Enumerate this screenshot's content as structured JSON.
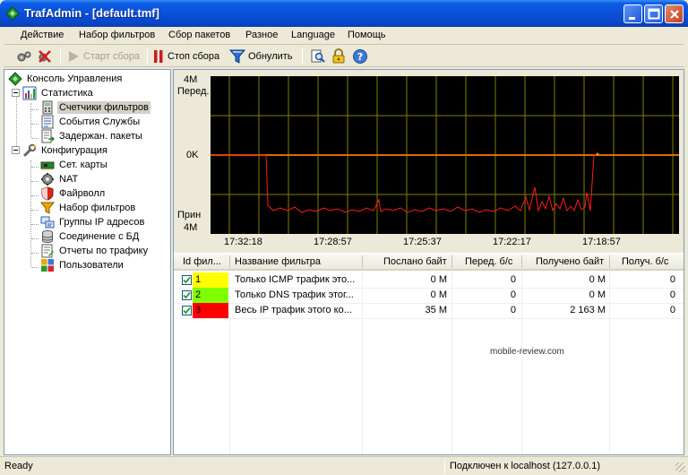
{
  "window": {
    "title": "TrafAdmin - [default.tmf]"
  },
  "menu": [
    "Действие",
    "Набор фильтров",
    "Сбор пакетов",
    "Разное",
    "Language",
    "Помощь"
  ],
  "toolbar": {
    "start_label": "Старт сбора",
    "stop_label": "Стоп сбора",
    "reset_label": "Обнулить"
  },
  "tree": {
    "root": "Консоль Управления",
    "stats": "Статистика",
    "stats_items": [
      "Счетчики фильтров",
      "События Службы",
      "Задержан. пакеты"
    ],
    "config": "Конфигурация",
    "config_items": [
      "Сет. карты",
      "NAT",
      "Файрволл",
      "Набор фильтров",
      "Группы IP адресов",
      "Соединение с БД",
      "Отчеты по трафику",
      "Пользователи"
    ]
  },
  "chart": {
    "top_value": "4M",
    "top_label": "Перед.",
    "mid_value": "0K",
    "bottom_label": "Прин",
    "bottom_value": "4M",
    "time_labels": [
      "17:32:18",
      "17:28:57",
      "17:25:37",
      "17:22:17",
      "17:18:57"
    ]
  },
  "table": {
    "columns": [
      "Id фил...",
      "Название фильтра",
      "Послано байт",
      "Перед. б/с",
      "Получено байт",
      "Получ. б/с"
    ],
    "rows": [
      {
        "id": "1",
        "name": "Только ICMP трафик это...",
        "sent": "0 M",
        "send_rate": "0",
        "received": "0 M",
        "recv_rate": "0",
        "color": "#ffff00"
      },
      {
        "id": "2",
        "name": "Только DNS трафик этог...",
        "sent": "0 M",
        "send_rate": "0",
        "received": "0 M",
        "recv_rate": "0",
        "color": "#80ff00"
      },
      {
        "id": "3",
        "name": "Весь IP трафик этого ко...",
        "sent": "35 M",
        "send_rate": "0",
        "received": "2 163 M",
        "recv_rate": "0",
        "color": "#ff0000"
      }
    ]
  },
  "watermark": "mobile-review.com",
  "status": {
    "left": "Ready",
    "right": "Подключен к localhost (127.0.0.1)"
  },
  "icons": {
    "app": "trafadmin-diamond-icon",
    "toolbar": [
      "gears-icon",
      "disconnect-icon",
      "play-icon",
      "pause-icon",
      "filter-icon",
      "magnifier-icon",
      "lock-icon",
      "help-icon"
    ]
  }
}
